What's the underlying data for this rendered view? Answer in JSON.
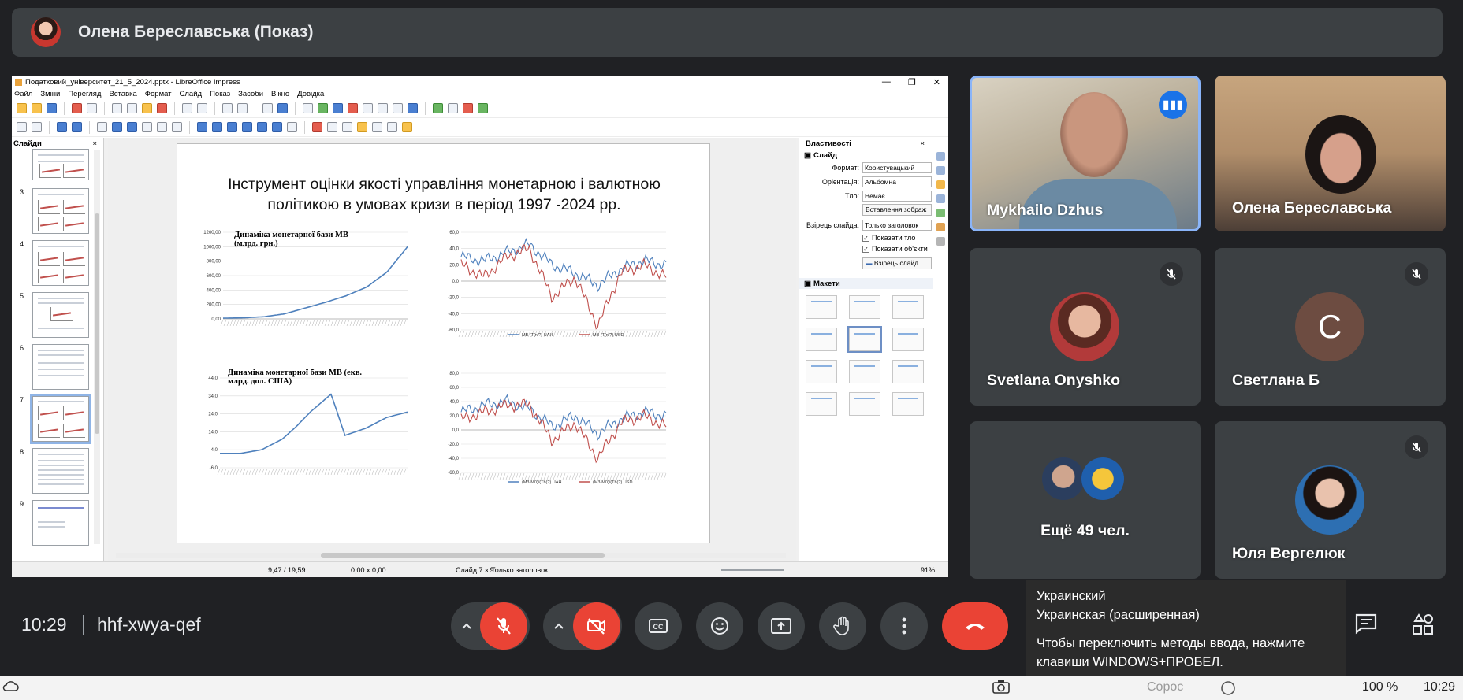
{
  "presenter_banner": {
    "name": "Олена Береславська (Показ)"
  },
  "impress": {
    "window_title": "Податковий_університет_21_5_2024.pptx - LibreOffice Impress",
    "menu": [
      "Файл",
      "Зміни",
      "Перегляд",
      "Вставка",
      "Формат",
      "Слайд",
      "Показ",
      "Засоби",
      "Вікно",
      "Довідка"
    ],
    "slides_panel_title": "Слайди",
    "slide_numbers": [
      "3",
      "4",
      "5",
      "6",
      "7",
      "8",
      "9"
    ],
    "selected_slide": "7",
    "slide": {
      "title": "Інструмент оцінки якості управління монетарною і валютною політикою в умовах кризи в період 1997 -2024 рр."
    },
    "properties": {
      "panel_title": "Властивості",
      "section_slide": "Слайд",
      "format_label": "Формат:",
      "format_value": "Користувацький",
      "orientation_label": "Орієнтація:",
      "orientation_value": "Альбомна",
      "background_label": "Тло:",
      "background_value": "Немає",
      "insert_image_button": "Вставлення зображ",
      "master_label": "Взірець слайда:",
      "master_value": "Только заголовок",
      "show_background": "Показати тло",
      "show_objects": "Показати об'єкти",
      "master_slide_button": "Взірець слайд",
      "section_layouts": "Макети"
    },
    "status": {
      "position": "9,47 / 19,59",
      "size": "0,00 x 0,00",
      "slide_count": "Слайд 7 з 9",
      "layout": "Только заголовок",
      "zoom": "91%"
    }
  },
  "chart_data": [
    {
      "type": "line",
      "title": "Динаміка монетарної бази МВ (млрд. грн.)",
      "y_ticks": [
        "1200,00",
        "1000,00",
        "800,00",
        "600,00",
        "400,00",
        "200,00",
        "0,00"
      ],
      "ylim": [
        0,
        1200
      ],
      "x": [
        1997,
        2000,
        2003,
        2006,
        2009,
        2012,
        2015,
        2018,
        2021,
        2024
      ],
      "series": [
        {
          "values": [
            10,
            15,
            30,
            70,
            150,
            230,
            320,
            440,
            650,
            1000
          ]
        }
      ],
      "colors": [
        "#4f81bd"
      ]
    },
    {
      "type": "line",
      "y_ticks": [
        "60,0",
        "40,0",
        "20,0",
        "0,0",
        "-20,0",
        "-40,0",
        "-60,0"
      ],
      "ylim": [
        -60,
        60
      ],
      "x": [
        1997,
        2000,
        2003,
        2006,
        2009,
        2012,
        2015,
        2018,
        2021,
        2024
      ],
      "series": [
        {
          "name": "МВ (Т(n/?) UAH",
          "values": [
            30,
            25,
            35,
            45,
            20,
            10,
            -5,
            15,
            25,
            20
          ]
        },
        {
          "name": "МВ (Т(n/?) USD",
          "values": [
            20,
            5,
            30,
            40,
            -20,
            5,
            -55,
            10,
            20,
            5
          ]
        }
      ],
      "colors": [
        "#4f81bd",
        "#c0504d"
      ]
    },
    {
      "type": "line",
      "title": "Динаміка монетарної бази МВ (екв. млрд. дол. США)",
      "y_ticks": [
        "44,0",
        "34,0",
        "24,0",
        "14,0",
        "4,0",
        "-6,0"
      ],
      "ylim": [
        -6,
        44
      ],
      "x": [
        1997,
        2000,
        2003,
        2006,
        2008,
        2010,
        2013,
        2015,
        2018,
        2021,
        2024
      ],
      "series": [
        {
          "values": [
            2,
            2,
            4,
            10,
            17,
            25,
            35,
            12,
            16,
            22,
            25
          ]
        }
      ],
      "colors": [
        "#4f81bd"
      ]
    },
    {
      "type": "line",
      "y_ticks": [
        "80,0",
        "60,0",
        "40,0",
        "20,0",
        "0,0",
        "-20,0",
        "-40,0",
        "-60,0"
      ],
      "ylim": [
        -60,
        80
      ],
      "x": [
        1997,
        2000,
        2003,
        2006,
        2009,
        2012,
        2015,
        2018,
        2021,
        2024
      ],
      "series": [
        {
          "name": "(M3-M0)/(Th(?) UAH",
          "values": [
            25,
            35,
            40,
            30,
            5,
            20,
            -5,
            15,
            25,
            20
          ]
        },
        {
          "name": "(M3-M0)/(Th(?) USD",
          "values": [
            15,
            25,
            35,
            35,
            -15,
            10,
            -40,
            10,
            20,
            5
          ]
        }
      ],
      "colors": [
        "#4f81bd",
        "#c0504d"
      ]
    }
  ],
  "participants": [
    {
      "name": "Mykhailo Dzhus",
      "speaking": true
    },
    {
      "name": "Олена Береславська"
    },
    {
      "name": "Svetlana Onyshko",
      "muted": true
    },
    {
      "name": "Светлана Б",
      "initial": "С",
      "muted": true,
      "color": "#6d4c41"
    },
    {
      "name": "Ещё 49 чел."
    },
    {
      "name": "Юля Вергелюк",
      "muted": true
    }
  ],
  "meeting": {
    "time": "10:29",
    "code": "hhf-xwya-qef"
  },
  "ime_tooltip": {
    "line1": "Украинский",
    "line2": "Украинская (расширенная)",
    "line3": "Чтобы переключить методы ввода, нажмите",
    "line4": "клавиши WINDOWS+ПРОБЕЛ."
  },
  "taskbar": {
    "volume": "100 %",
    "time": "10:29",
    "partial_text": "Сорос"
  }
}
